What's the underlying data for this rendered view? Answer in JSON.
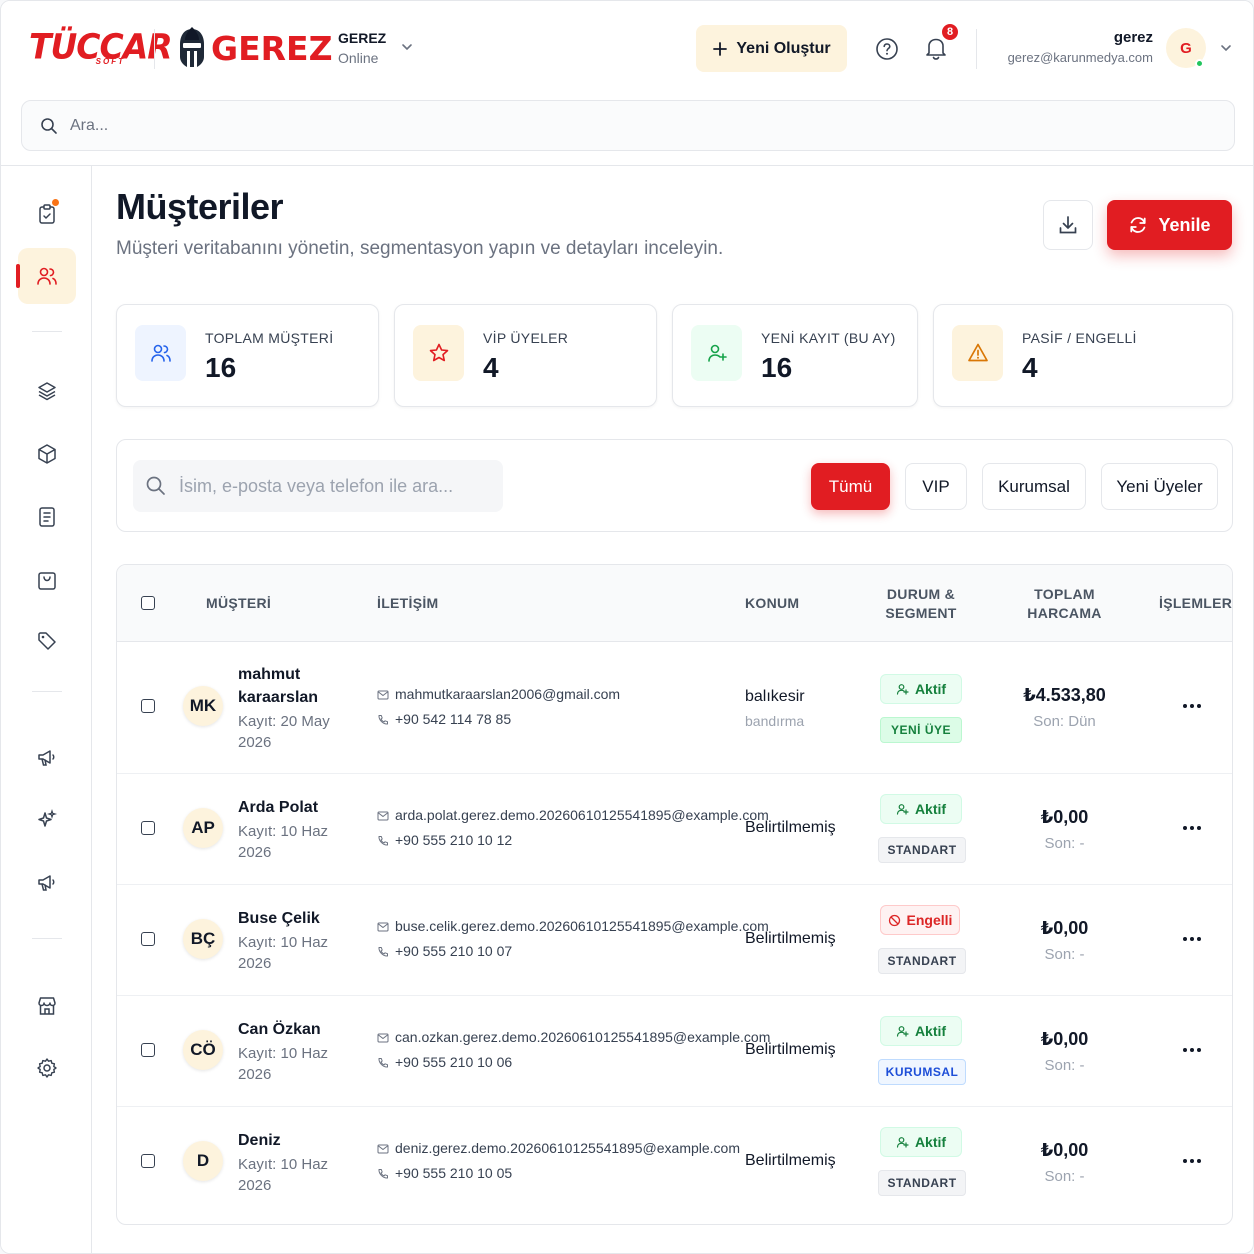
{
  "header": {
    "logo_tuccar": "TÜCCAR",
    "logo_tuccar_sub": "SOFT",
    "logo_gerez": "GEREZ",
    "brand_name": "GEREZ",
    "brand_status": "Online",
    "create_label": "Yeni Oluştur",
    "notification_count": "8",
    "user_name": "gerez",
    "user_email": "gerez@karunmedya.com",
    "user_initial": "G"
  },
  "search": {
    "placeholder": "Ara..."
  },
  "page": {
    "title": "Müşteriler",
    "subtitle": "Müşteri veritabanını yönetin, segmentasyon yapın ve detayları inceleyin.",
    "refresh_label": "Yenile"
  },
  "stats": [
    {
      "label": "TOPLAM MÜŞTERİ",
      "value": "16",
      "color": "#2563eb"
    },
    {
      "label": "VİP ÜYELER",
      "value": "4",
      "color": "#e11d22"
    },
    {
      "label": "YENİ KAYIT (BU AY)",
      "value": "16",
      "color": "#16a34a"
    },
    {
      "label": "PASİF / ENGELLİ",
      "value": "4",
      "color": "#d97706"
    }
  ],
  "filters": {
    "placeholder": "İsim, e-posta veya telefon ile ara...",
    "chips": [
      "Tümü",
      "VIP",
      "Kurumsal",
      "Yeni Üyeler"
    ]
  },
  "table": {
    "columns": {
      "customer": "MÜŞTERİ",
      "contact": "İLETİŞİM",
      "location": "KONUM",
      "status_a": "DURUM &",
      "status_b": "SEGMENT",
      "spend_a": "TOPLAM",
      "spend_b": "HARCAMA",
      "actions": "İŞLEMLER"
    },
    "rows": [
      {
        "initials": "MK",
        "name": "mahmut karaarslan",
        "registered": "Kayıt: 20 May 2026",
        "email": "mahmutkaraarslan2006@gmail.com",
        "phone": "+90 542 114 78 85",
        "city": "balıkesir",
        "district": "bandırma",
        "status": "Aktif",
        "segment": "YENİ ÜYE",
        "amount": "₺4.533,80",
        "last": "Son: Dün"
      },
      {
        "initials": "AP",
        "name": "Arda Polat",
        "registered": "Kayıt: 10 Haz 2026",
        "email": "arda.polat.gerez.demo.20260610125541895@example.com",
        "phone": "+90 555 210 10 12",
        "city": "Belirtilmemiş",
        "district": "",
        "status": "Aktif",
        "segment": "STANDART",
        "amount": "₺0,00",
        "last": "Son: -"
      },
      {
        "initials": "BÇ",
        "name": "Buse Çelik",
        "registered": "Kayıt: 10 Haz 2026",
        "email": "buse.celik.gerez.demo.20260610125541895@example.com",
        "phone": "+90 555 210 10 07",
        "city": "Belirtilmemiş",
        "district": "",
        "status": "Engelli",
        "segment": "STANDART",
        "amount": "₺0,00",
        "last": "Son: -"
      },
      {
        "initials": "CÖ",
        "name": "Can Özkan",
        "registered": "Kayıt: 10 Haz 2026",
        "email": "can.ozkan.gerez.demo.20260610125541895@example.com",
        "phone": "+90 555 210 10 06",
        "city": "Belirtilmemiş",
        "district": "",
        "status": "Aktif",
        "segment": "KURUMSAL",
        "amount": "₺0,00",
        "last": "Son: -"
      },
      {
        "initials": "D",
        "name": "Deniz",
        "registered": "Kayıt: 10 Haz 2026",
        "email": "deniz.gerez.demo.20260610125541895@example.com",
        "phone": "+90 555 210 10 05",
        "city": "Belirtilmemiş",
        "district": "",
        "status": "Aktif",
        "segment": "STANDART",
        "amount": "₺0,00",
        "last": "Son: -"
      }
    ]
  },
  "colors": {
    "brand": "#e11d22",
    "accent_soft": "#fdf3dd",
    "success": "#15803d"
  }
}
